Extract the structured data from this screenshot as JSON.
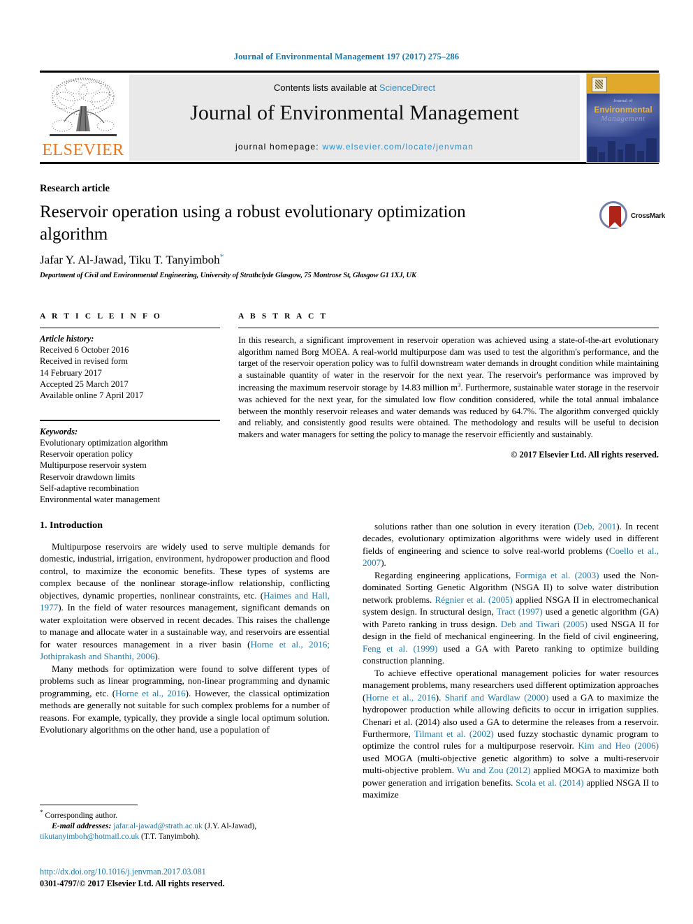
{
  "running_head": "Journal of Environmental Management 197 (2017) 275–286",
  "masthead": {
    "contents_prefix": "Contents lists available at ",
    "sciencedirect": "ScienceDirect",
    "journal_title": "Journal of Environmental Management",
    "homepage_prefix": "journal homepage: ",
    "homepage_url": "www.elsevier.com/locate/jenvman",
    "publisher": "ELSEVIER",
    "cover": {
      "journal_word": "Journal of",
      "environmental": "Environmental",
      "management": "Management"
    },
    "link_color": "#2a8fd0",
    "band_color": "#e9e9e9",
    "elsevier_orange": "#e87722"
  },
  "article": {
    "type": "Research article",
    "title": "Reservoir operation using a robust evolutionary optimization algorithm",
    "authors": "Jafar Y. Al-Jawad, Tiku T. Tanyimboh",
    "corresponding_mark": "*",
    "affiliation": "Department of Civil and Environmental Engineering, University of Strathclyde Glasgow, 75 Montrose St, Glasgow G1 1XJ, UK",
    "crossmark_label": "CrossMark"
  },
  "article_info": {
    "heading": "A R T I C L E  I N F O",
    "history_label": "Article history:",
    "history": [
      "Received 6 October 2016",
      "Received in revised form",
      "14 February 2017",
      "Accepted 25 March 2017",
      "Available online 7 April 2017"
    ],
    "keywords_label": "Keywords:",
    "keywords": [
      "Evolutionary optimization algorithm",
      "Reservoir operation policy",
      "Multipurpose reservoir system",
      "Reservoir drawdown limits",
      "Self-adaptive recombination",
      "Environmental water management"
    ]
  },
  "abstract": {
    "heading": "A B S T R A C T",
    "text_part1": "In this research, a significant improvement in reservoir operation was achieved using a state-of-the-art evolutionary algorithm named Borg MOEA. A real-world multipurpose dam was used to test the algorithm's performance, and the target of the reservoir operation policy was to fulfil downstream water demands in drought condition while maintaining a sustainable quantity of water in the reservoir for the next year. The reservoir's performance was improved by increasing the maximum reservoir storage by 14.83 million m",
    "superscript": "3",
    "text_part2": ". Furthermore, sustainable water storage in the reservoir was achieved for the next year, for the simulated low flow condition considered, while the total annual imbalance between the monthly reservoir releases and water demands was reduced by 64.7%. The algorithm converged quickly and reliably, and consistently good results were obtained. The methodology and results will be useful to decision makers and water managers for setting the policy to manage the reservoir efficiently and sustainably.",
    "copyright": "© 2017 Elsevier Ltd. All rights reserved."
  },
  "body": {
    "section_title": "1. Introduction",
    "left_paragraphs": [
      {
        "runs": [
          {
            "t": "Multipurpose reservoirs are widely used to serve multiple demands for domestic, industrial, irrigation, environment, hydropower production and flood control, to maximize the economic benefits. These types of systems are complex because of the nonlinear storage-inflow relationship, conflicting objectives, dynamic properties, nonlinear constraints, etc. ("
          },
          {
            "t": "Haimes and Hall, 1977",
            "ref": true
          },
          {
            "t": "). In the field of water resources management, significant demands on water exploitation were observed in recent decades. This raises the challenge to manage and allocate water in a sustainable way, and reservoirs are essential for water resources management in a river basin ("
          },
          {
            "t": "Horne et al., 2016; Jothiprakash and Shanthi, 2006",
            "ref": true
          },
          {
            "t": ")."
          }
        ]
      },
      {
        "runs": [
          {
            "t": "Many methods for optimization were found to solve different types of problems such as linear programming, non-linear programming and dynamic programming, etc. ("
          },
          {
            "t": "Horne et al., 2016",
            "ref": true
          },
          {
            "t": "). However, the classical optimization methods are generally not suitable for such complex problems for a number of reasons. For example, typically, they provide a single local optimum solution. Evolutionary algorithms on the other hand, use a population of"
          }
        ]
      }
    ],
    "right_paragraphs": [
      {
        "runs": [
          {
            "t": "solutions rather than one solution in every iteration ("
          },
          {
            "t": "Deb, 2001",
            "ref": true
          },
          {
            "t": "). In recent decades, evolutionary optimization algorithms were widely used in different fields of engineering and science to solve real-world problems ("
          },
          {
            "t": "Coello et al., 2007",
            "ref": true
          },
          {
            "t": ")."
          }
        ]
      },
      {
        "runs": [
          {
            "t": "Regarding engineering applications, "
          },
          {
            "t": "Formiga et al. (2003)",
            "ref": true
          },
          {
            "t": " used the Non-dominated Sorting Genetic Algorithm (NSGA II) to solve water distribution network problems. "
          },
          {
            "t": "Régnier et al. (2005)",
            "ref": true
          },
          {
            "t": " applied NSGA II in electromechanical system design. In structural design, "
          },
          {
            "t": "Tract (1997)",
            "ref": true
          },
          {
            "t": " used a genetic algorithm (GA) with Pareto ranking in truss design. "
          },
          {
            "t": "Deb and Tiwari (2005)",
            "ref": true
          },
          {
            "t": " used NSGA II for design in the field of mechanical engineering. In the field of civil engineering, "
          },
          {
            "t": "Feng et al. (1999)",
            "ref": true
          },
          {
            "t": " used a GA with Pareto ranking to optimize building construction planning."
          }
        ]
      },
      {
        "runs": [
          {
            "t": "To achieve effective operational management policies for water resources management problems, many researchers used different optimization approaches ("
          },
          {
            "t": "Horne et al., 2016",
            "ref": true
          },
          {
            "t": "). "
          },
          {
            "t": "Sharif and Wardlaw (2000)",
            "ref": true
          },
          {
            "t": " used a GA to maximize the hydropower production while allowing deficits to occur in irrigation supplies. Chenari et al. (2014) also used a GA to determine the releases from a reservoir. Furthermore, "
          },
          {
            "t": "Tilmant et al. (2002)",
            "ref": true
          },
          {
            "t": " used fuzzy stochastic dynamic program to optimize the control rules for a multipurpose reservoir. "
          },
          {
            "t": "Kim and Heo (2006)",
            "ref": true
          },
          {
            "t": " used MOGA (multi-objective genetic algorithm) to solve a multi-reservoir multi-objective problem. "
          },
          {
            "t": "Wu and Zou (2012)",
            "ref": true
          },
          {
            "t": " applied MOGA to maximize both power generation and irrigation benefits. "
          },
          {
            "t": "Scola et al. (2014)",
            "ref": true
          },
          {
            "t": " applied NSGA II to maximize"
          }
        ]
      }
    ]
  },
  "footnotes": {
    "corresponding": "Corresponding author.",
    "corresponding_mark": "*",
    "email_label": "E-mail addresses:",
    "email1": "jafar.al-jawad@strath.ac.uk",
    "email1_name": "(J.Y. Al-Jawad),",
    "email2": "tikutanyimboh@hotmail.co.uk",
    "email2_name": "(T.T. Tanyimboh).",
    "doi": "http://dx.doi.org/10.1016/j.jenvman.2017.03.081",
    "issn": "0301-4797/© 2017 Elsevier Ltd. All rights reserved."
  }
}
